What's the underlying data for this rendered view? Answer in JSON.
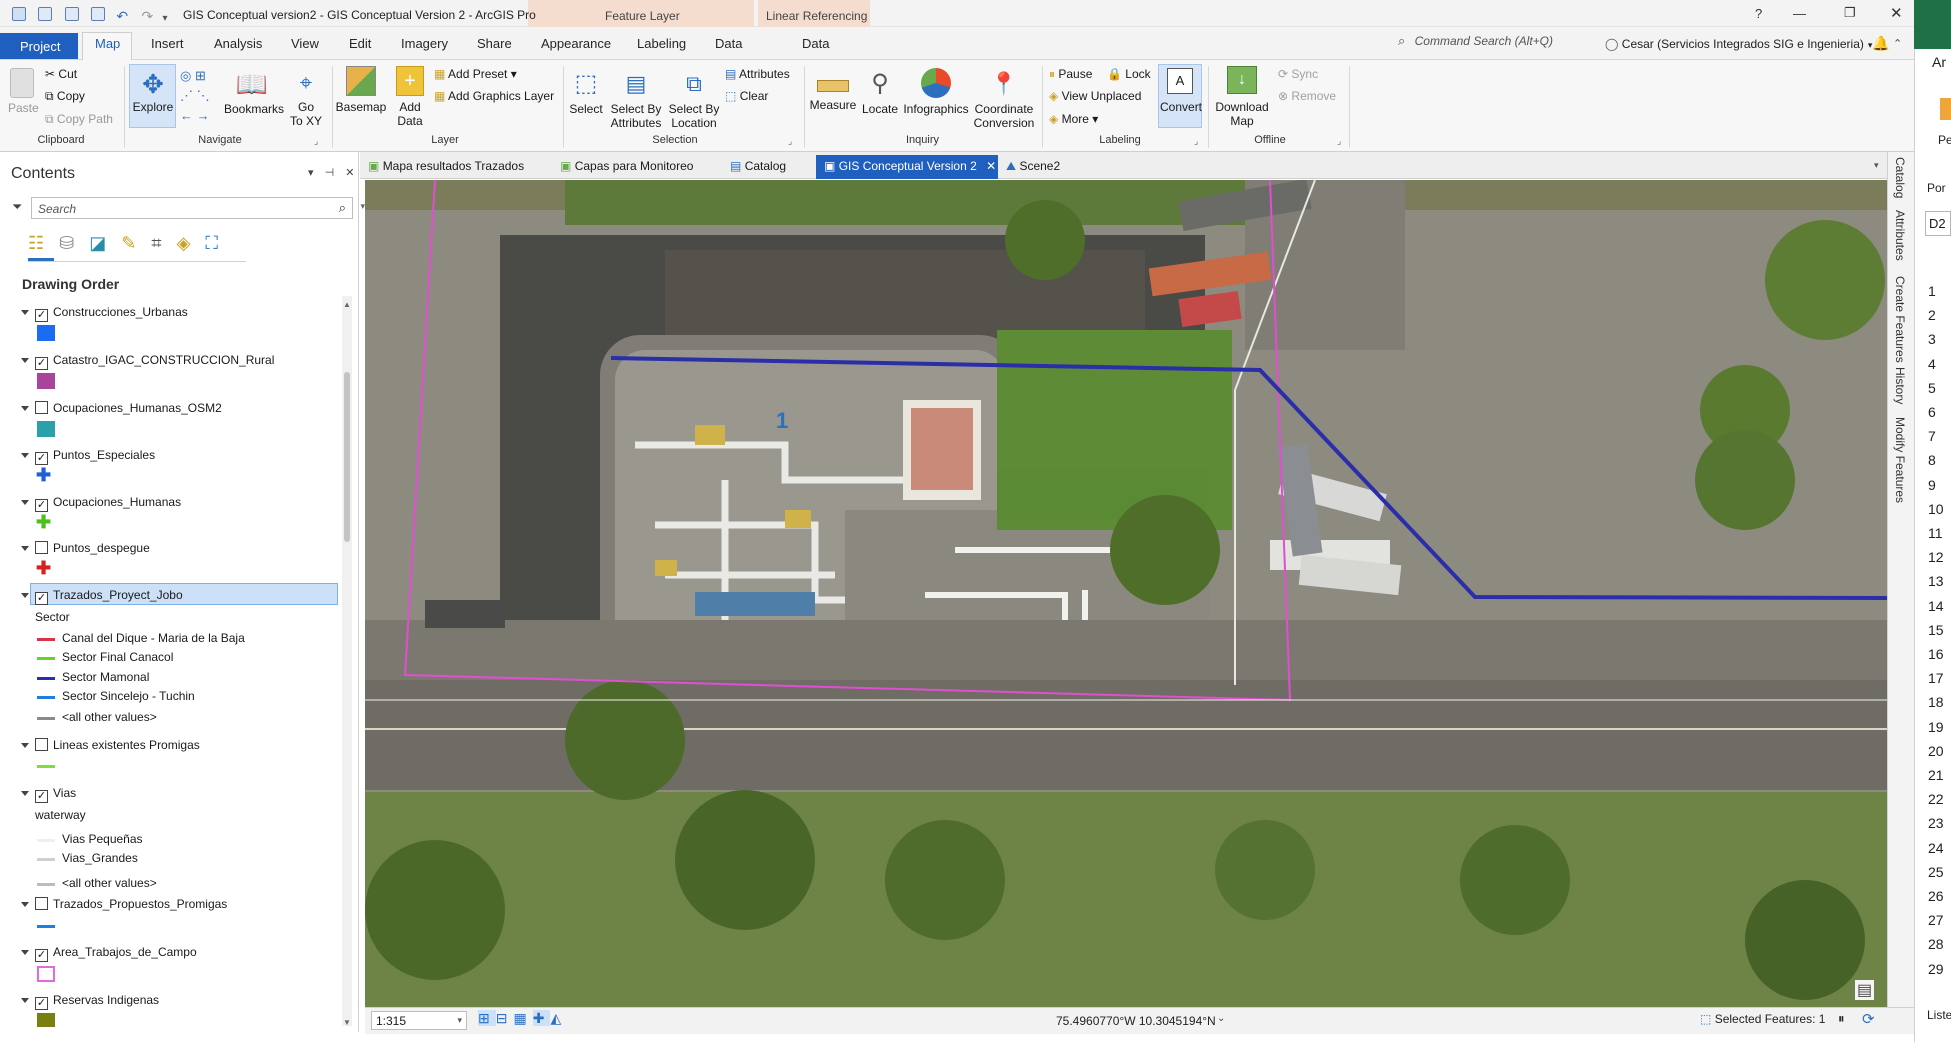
{
  "window": {
    "title": "GIS Conceptual version2 - GIS Conceptual Version 2 - ArcGIS Pro",
    "help": "?"
  },
  "contextual": {
    "feature_layer": "Feature Layer",
    "linear_referencing": "Linear Referencing"
  },
  "tabs": [
    "Project",
    "Map",
    "Insert",
    "Analysis",
    "View",
    "Edit",
    "Imagery",
    "Share",
    "Appearance",
    "Labeling",
    "Data",
    "Data"
  ],
  "command_search": {
    "placeholder": "Command Search (Alt+Q)"
  },
  "user": "Cesar (Servicios Integrados SIG e Ingenieria)",
  "ribbon": {
    "clipboard": {
      "paste": "Paste",
      "cut": "Cut",
      "copy": "Copy",
      "copy_path": "Copy Path",
      "group": "Clipboard"
    },
    "navigate": {
      "explore": "Explore",
      "bookmarks": "Bookmarks",
      "goto1": "Go",
      "goto2": "To XY",
      "group": "Navigate"
    },
    "layer": {
      "basemap": "Basemap",
      "add_data1": "Add",
      "add_data2": "Data",
      "add_preset": "Add Preset",
      "add_graphics": "Add Graphics Layer",
      "group": "Layer"
    },
    "selection": {
      "select": "Select",
      "sba1": "Select By",
      "sba2": "Attributes",
      "sbl1": "Select By",
      "sbl2": "Location",
      "attributes": "Attributes",
      "clear": "Clear",
      "group": "Selection"
    },
    "inquiry": {
      "measure": "Measure",
      "locate": "Locate",
      "infographics": "Infographics",
      "coord1": "Coordinate",
      "coord2": "Conversion",
      "group": "Inquiry"
    },
    "labeling": {
      "pause": "Pause",
      "lock": "Lock",
      "view_unplaced": "View Unplaced",
      "more": "More",
      "convert": "Convert",
      "group": "Labeling"
    },
    "offline": {
      "download1": "Download",
      "download2": "Map",
      "sync": "Sync",
      "remove": "Remove",
      "group": "Offline"
    }
  },
  "contents": {
    "title": "Contents",
    "search_placeholder": "Search",
    "drawing_order": "Drawing Order",
    "layers": [
      {
        "name": "Construcciones_Urbanas",
        "checked": true,
        "color": "#1a6cf0"
      },
      {
        "name": "Catastro_IGAC_CONSTRUCCION_Rural",
        "checked": true,
        "color": "#a8449a"
      },
      {
        "name": "Ocupaciones_Humanas_OSM2",
        "checked": false,
        "color": "#2aa0a8"
      },
      {
        "name": "Puntos_Especiales",
        "checked": true,
        "color": "#1f5fd8"
      },
      {
        "name": "Ocupaciones_Humanas",
        "checked": true,
        "color": "#4fbf1f"
      },
      {
        "name": "Puntos_despegue",
        "checked": false,
        "color": "#d81f1f"
      },
      {
        "name": "Trazados_Proyect_Jobo",
        "checked": true
      },
      {
        "name": "Lineas existentes Promigas",
        "checked": false,
        "color": "#7ee03a"
      },
      {
        "name": "Vias",
        "checked": true
      },
      {
        "name": "Trazados_Propuestos_Promigas",
        "checked": false,
        "color": "#1f7fe0"
      },
      {
        "name": "Area_Trabajos_de_Campo",
        "checked": true,
        "color": "#e06adf"
      },
      {
        "name": "Reservas Indigenas",
        "checked": true,
        "color": "#7a7f12"
      }
    ],
    "sector_heading": "Sector",
    "sector_items": [
      {
        "label": "Canal del Dique - Maria de la Baja",
        "color": "#d9334a"
      },
      {
        "label": "Sector Final Canacol",
        "color": "#5ed62a"
      },
      {
        "label": "Sector Mamonal",
        "color": "#2a2ea8"
      },
      {
        "label": "Sector Sincelejo - Tuchin",
        "color": "#1f7fe0"
      },
      {
        "label": "<all other values>",
        "color": "#8a8a8a"
      }
    ],
    "waterway_heading": "waterway",
    "waterway_items": [
      {
        "label": "Vias Pequeñas",
        "color": "#efefef"
      },
      {
        "label": "Vias_Grandes",
        "color": "#cfcfcf"
      },
      {
        "label": "<all other values>",
        "color": "#bcbcbc"
      }
    ]
  },
  "map_tabs": [
    "Mapa resultados Trazados",
    "Capas para Monitoreo",
    "Catalog",
    "GIS Conceptual Version 2",
    "Scene2"
  ],
  "side_tabs": [
    "Catalog",
    "Attributes",
    "Create Features",
    "History",
    "Modify Features"
  ],
  "map": {
    "label": "1"
  },
  "status": {
    "scale": "1:315",
    "coords": "75.4960770°W 10.3045194°N",
    "selected": "Selected Features: 1"
  },
  "excel": {
    "title_frag": "Ar",
    "label_frag": "Pe",
    "cell_ref": "D2",
    "por": "Por",
    "liste": "Liste",
    "rows": [
      "1",
      "2",
      "3",
      "4",
      "5",
      "6",
      "7",
      "8",
      "9",
      "10",
      "11",
      "12",
      "13",
      "14",
      "15",
      "16",
      "17",
      "18",
      "19",
      "20",
      "21",
      "22",
      "23",
      "24",
      "25",
      "26",
      "27",
      "28",
      "29"
    ]
  }
}
